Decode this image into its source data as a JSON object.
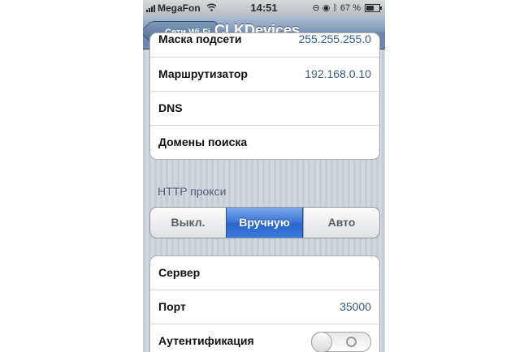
{
  "status_bar": {
    "carrier": "MegaFon",
    "time": "14:51",
    "battery": "67 %",
    "battery_level": 0.67,
    "icons": [
      "signal-bars-icon",
      "wifi-icon",
      "rotation-lock-icon",
      "bluetooth-icon",
      "battery-icon"
    ]
  },
  "nav": {
    "back_label": "Сети Wi-Fi",
    "title": "CLKDevices"
  },
  "ip_group": {
    "rows": [
      {
        "label": "Маска подсети",
        "value": "255.255.255.0"
      },
      {
        "label": "Маршрутизатор",
        "value": "192.168.0.10"
      },
      {
        "label": "DNS",
        "value": ""
      },
      {
        "label": "Домены поиска",
        "value": ""
      }
    ]
  },
  "proxy": {
    "header": "HTTP прокси",
    "segments": [
      "Выкл.",
      "Вручную",
      "Авто"
    ],
    "selected": "Вручную"
  },
  "proxy_group": {
    "rows": [
      {
        "label": "Сервер",
        "value": ""
      },
      {
        "label": "Порт",
        "value": "35000"
      },
      {
        "label": "Аутентификация",
        "toggle": "off"
      }
    ]
  },
  "colors": {
    "nav_bar": "#6d88aa",
    "selected_segment": "#3a74d4",
    "value_text": "#395a84"
  }
}
